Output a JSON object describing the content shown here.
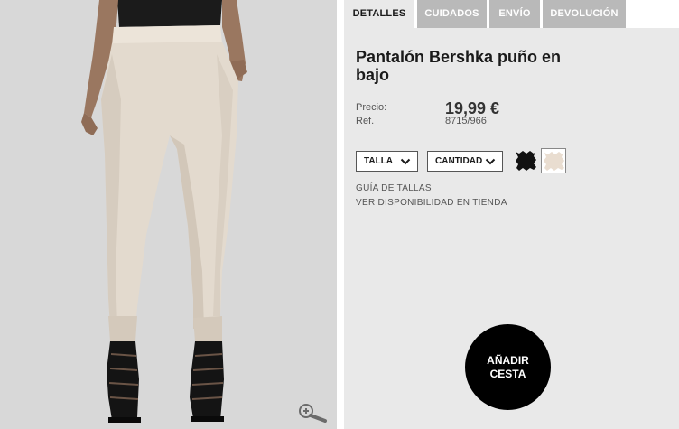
{
  "tabs": [
    {
      "label": "DETALLES",
      "active": true
    },
    {
      "label": "CUIDADOS",
      "active": false
    },
    {
      "label": "ENVÍO",
      "active": false
    },
    {
      "label": "DEVOLUCIÓN",
      "active": false
    }
  ],
  "product": {
    "title": "Pantalón Bershka puño en bajo",
    "price_label": "Precio:",
    "price": "19,99 €",
    "ref_label": "Ref.",
    "ref": "8715/966"
  },
  "options": {
    "size_label": "TALLA",
    "quantity_label": "CANTIDAD",
    "colors": [
      "#111111",
      "#e9ddd0"
    ]
  },
  "links": {
    "size_guide": "GUÍA DE TALLAS",
    "store_availability": "VER DISPONIBILIDAD EN TIENDA"
  },
  "cta": {
    "add_to_cart": "AÑADIR CESTA"
  },
  "icons": {
    "zoom": "zoom-in-icon",
    "chevron": "chevron-down-icon"
  }
}
